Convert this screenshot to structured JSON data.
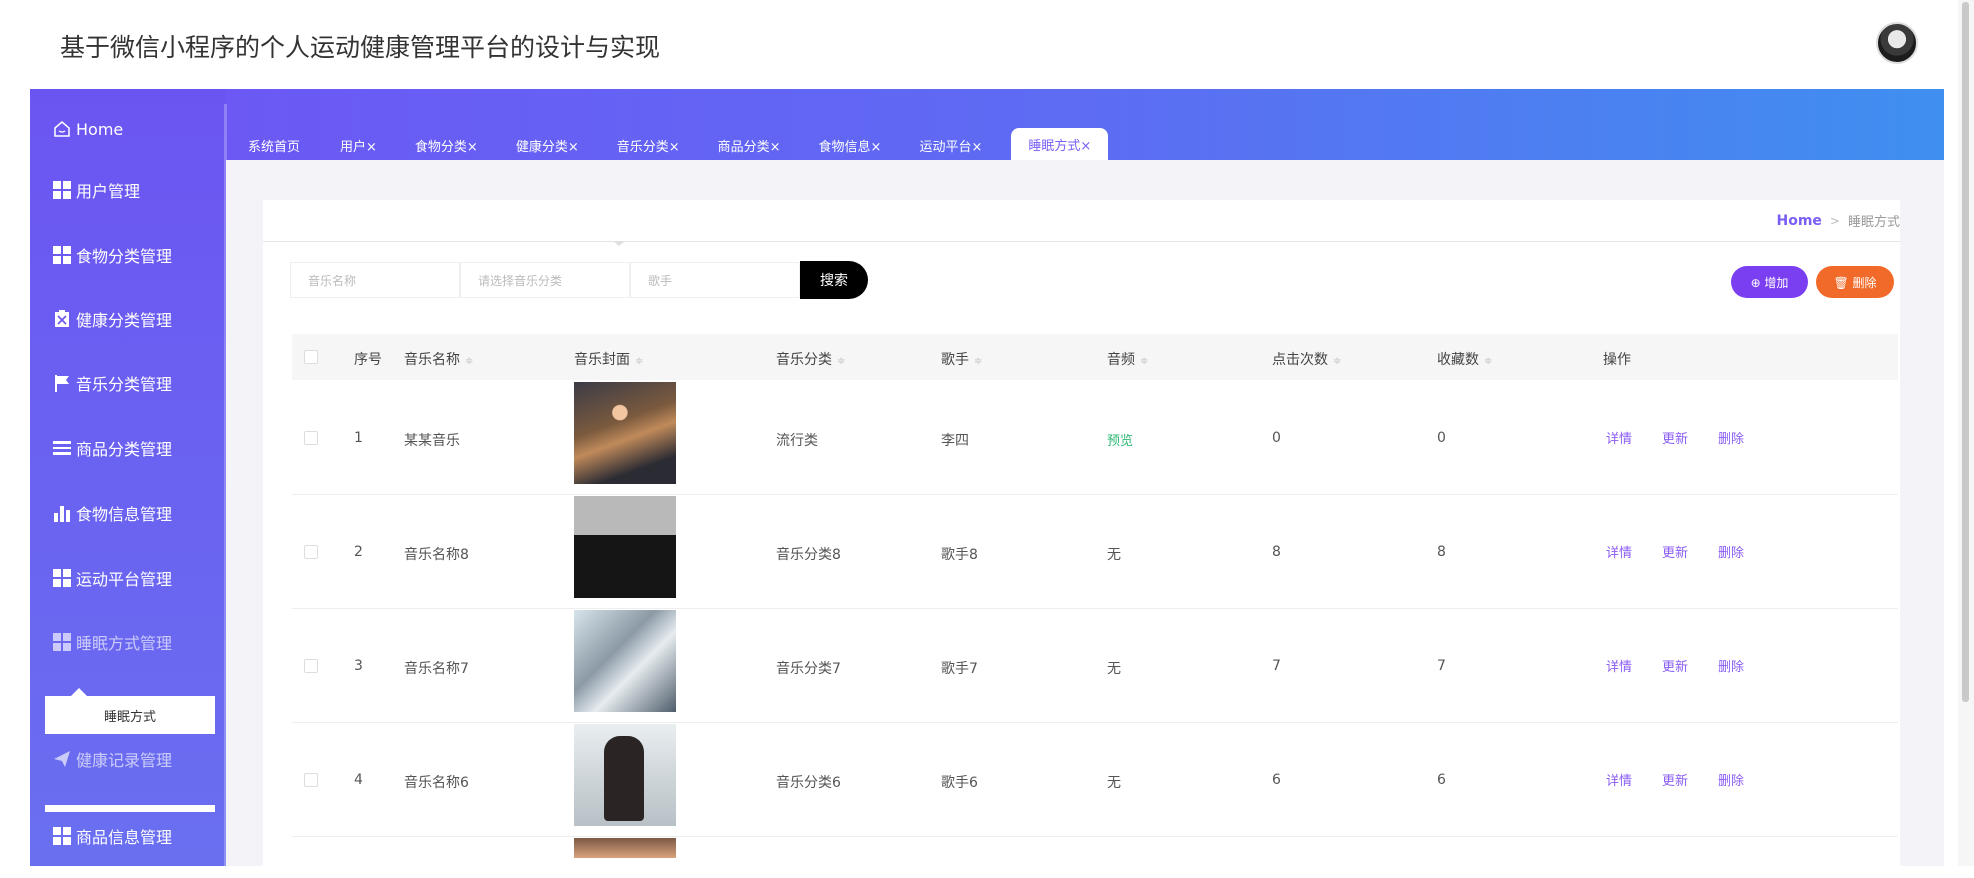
{
  "header": {
    "title": "基于微信小程序的个人运动健康管理平台的设计与实现",
    "avatar_icon": "user-avatar"
  },
  "sidebar": {
    "home": {
      "label": "Home",
      "icon": "home-icon"
    },
    "items": [
      {
        "label": "用户管理",
        "icon": "grid-icon"
      },
      {
        "label": "食物分类管理",
        "icon": "grid-icon"
      },
      {
        "label": "健康分类管理",
        "icon": "clipboard-icon"
      },
      {
        "label": "音乐分类管理",
        "icon": "flag-icon"
      },
      {
        "label": "商品分类管理",
        "icon": "list-icon"
      },
      {
        "label": "食物信息管理",
        "icon": "bar-chart-icon"
      },
      {
        "label": "运动平台管理",
        "icon": "grid-icon"
      },
      {
        "label": "睡眠方式管理",
        "icon": "grid-icon"
      },
      {
        "label": "健康记录管理",
        "icon": "paper-plane-icon"
      },
      {
        "label": "商品信息管理",
        "icon": "grid-icon"
      }
    ],
    "submenu": {
      "label": "睡眠方式"
    }
  },
  "tabs": [
    {
      "label": "系统首页"
    },
    {
      "label": "用户×"
    },
    {
      "label": "食物分类×"
    },
    {
      "label": "健康分类×"
    },
    {
      "label": "音乐分类×"
    },
    {
      "label": "商品分类×"
    },
    {
      "label": "食物信息×"
    },
    {
      "label": "运动平台×"
    },
    {
      "label": "睡眠方式×"
    }
  ],
  "breadcrumb": {
    "home": "Home",
    "separator": ">",
    "current": "睡眠方式"
  },
  "search": {
    "name_placeholder": "音乐名称",
    "category_placeholder": "请选择音乐分类",
    "singer_placeholder": "歌手",
    "button": "搜索"
  },
  "actions": {
    "add": "⊕ 增加",
    "delete": "🗑 删除"
  },
  "table": {
    "columns": [
      "序号",
      "音乐名称",
      "音乐封面",
      "音乐分类",
      "歌手",
      "音频",
      "点击次数",
      "收藏数",
      "操作"
    ],
    "sort_glyph": "≑",
    "row_actions": [
      "详情",
      "更新",
      "删除"
    ],
    "rows": [
      {
        "index": "1",
        "name": "某某音乐",
        "category": "流行类",
        "singer": "李四",
        "audio": "预览",
        "clicks": "0",
        "favorites": "0"
      },
      {
        "index": "2",
        "name": "音乐名称8",
        "category": "音乐分类8",
        "singer": "歌手8",
        "audio": "无",
        "clicks": "8",
        "favorites": "8"
      },
      {
        "index": "3",
        "name": "音乐名称7",
        "category": "音乐分类7",
        "singer": "歌手7",
        "audio": "无",
        "clicks": "7",
        "favorites": "7"
      },
      {
        "index": "4",
        "name": "音乐名称6",
        "category": "音乐分类6",
        "singer": "歌手6",
        "audio": "无",
        "clicks": "6",
        "favorites": "6"
      }
    ]
  },
  "colors": {
    "accent": "#7b5ef6",
    "band_start": "#6f54f5",
    "band_end": "#3f8ff0",
    "add_button": "#7b3ff2",
    "delete_button": "#f26a2a",
    "audio_link": "#2eb872"
  }
}
